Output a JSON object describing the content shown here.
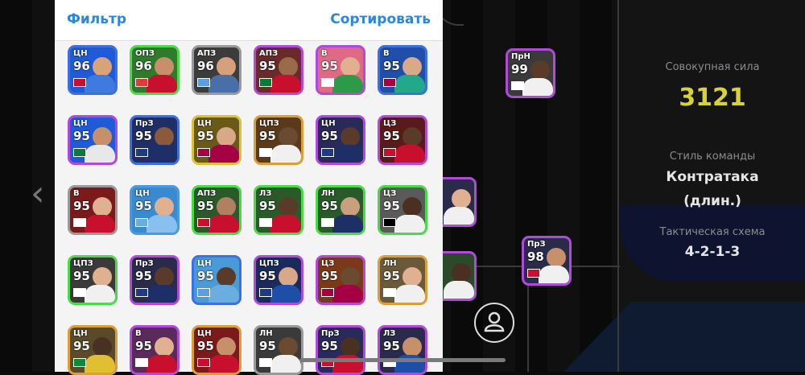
{
  "sidebar": {
    "filter_label": "Фильтр",
    "sort_label": "Сортировать"
  },
  "players": [
    {
      "position": "ЦН",
      "rating": "96",
      "border": "#3d6fe0",
      "bg": "#1f5bd8",
      "flag": "#c8102e",
      "head": "#d9a37a",
      "body": "#3e7be0"
    },
    {
      "position": "ОПЗ",
      "rating": "96",
      "border": "#4cd94a",
      "bg": "#2f7a2c",
      "flag": "#e03a3a",
      "head": "#c8906a",
      "body": "#c8102e"
    },
    {
      "position": "АПЗ",
      "rating": "96",
      "border": "#9a9a9a",
      "bg": "#3c3c3c",
      "flag": "#5aa0e0",
      "head": "#d6a07c",
      "body": "#4a6ea8"
    },
    {
      "position": "АПЗ",
      "rating": "95",
      "border": "#b04ad9",
      "bg": "#6b2a2a",
      "flag": "#0a7a3a",
      "head": "#9b6a4a",
      "body": "#c8102e"
    },
    {
      "position": "В",
      "rating": "95",
      "border": "#b04ad9",
      "bg": "#e06a86",
      "flag": "#ffffff",
      "head": "#e0b090",
      "body": "#2d9a4a"
    },
    {
      "position": "В",
      "rating": "95",
      "border": "#3d6fe0",
      "bg": "#1f4fa8",
      "flag": "#a50044",
      "head": "#d8aa8a",
      "body": "#22a88a"
    },
    {
      "position": "ЦН",
      "rating": "95",
      "border": "#b04ad9",
      "bg": "#1f5bd8",
      "flag": "#0a7a3a",
      "head": "#c8906a",
      "body": "#e8e8e8"
    },
    {
      "position": "ПрЗ",
      "rating": "95",
      "border": "#3d6fe0",
      "bg": "#1f2e66",
      "flag": "#1e3a8a",
      "head": "#8a5a3a",
      "body": "#1e2e66"
    },
    {
      "position": "ЦН",
      "rating": "95",
      "border": "#d9c23a",
      "bg": "#6a5a1a",
      "flag": "#a50044",
      "head": "#d8a888",
      "body": "#a50044"
    },
    {
      "position": "ЦПЗ",
      "rating": "95",
      "border": "#d9a03a",
      "bg": "#5a3a1a",
      "flag": "#ffffff",
      "head": "#6a4a30",
      "body": "#f0f0f0"
    },
    {
      "position": "ЦН",
      "rating": "95",
      "border": "#b04ad9",
      "bg": "#2a2a5a",
      "flag": "#1e3a8a",
      "head": "#5a3a28",
      "body": "#1e2e66"
    },
    {
      "position": "ЦЗ",
      "rating": "95",
      "border": "#b04ad9",
      "bg": "#5a1a1a",
      "flag": "#c8102e",
      "head": "#5a3a28",
      "body": "#c8102e"
    },
    {
      "position": "В",
      "rating": "95",
      "border": "#9a9a9a",
      "bg": "#7a1a1a",
      "flag": "#ffffff",
      "head": "#e0b090",
      "body": "#c8102e"
    },
    {
      "position": "ЦН",
      "rating": "95",
      "border": "#4a9ae0",
      "bg": "#3a8ad0",
      "flag": "#6aaee0",
      "head": "#e0b090",
      "body": "#8ac0f0"
    },
    {
      "position": "АПЗ",
      "rating": "95",
      "border": "#4cd94a",
      "bg": "#2a5a2a",
      "flag": "#c8102e",
      "head": "#b08060",
      "body": "#c8102e"
    },
    {
      "position": "ЛЗ",
      "rating": "95",
      "border": "#4cd94a",
      "bg": "#2a5a2a",
      "flag": "#ffffff",
      "head": "#5a3a28",
      "body": "#c8102e"
    },
    {
      "position": "ЛН",
      "rating": "95",
      "border": "#4cd94a",
      "bg": "#2a5a2a",
      "flag": "#ffffff",
      "head": "#c8a080",
      "body": "#1e2e66"
    },
    {
      "position": "ЦЗ",
      "rating": "95",
      "border": "#4cd94a",
      "bg": "#5a5a5a",
      "flag": "#000000",
      "head": "#4a3020",
      "body": "#f0f0f0"
    },
    {
      "position": "ЦПЗ",
      "rating": "95",
      "border": "#4cd94a",
      "bg": "#3a3a3a",
      "flag": "#ffffff",
      "head": "#e0b090",
      "body": "#f0f0f0"
    },
    {
      "position": "ПрЗ",
      "rating": "95",
      "border": "#b04ad9",
      "bg": "#2a2a4a",
      "flag": "#1e3a8a",
      "head": "#5a3a28",
      "body": "#1e2e66"
    },
    {
      "position": "ЦН",
      "rating": "95",
      "border": "#3d6fe0",
      "bg": "#4a9ad8",
      "flag": "#5aa0e0",
      "head": "#5a3a28",
      "body": "#6aaee0"
    },
    {
      "position": "ЦПЗ",
      "rating": "95",
      "border": "#b04ad9",
      "bg": "#1a2a5a",
      "flag": "#1e3a8a",
      "head": "#d8a888",
      "body": "#1e4fa8"
    },
    {
      "position": "ЦЗ",
      "rating": "95",
      "border": "#b04ad9",
      "bg": "#7a3a1a",
      "flag": "#a50044",
      "head": "#6a4a30",
      "body": "#a50044"
    },
    {
      "position": "ЛН",
      "rating": "95",
      "border": "#d9a03a",
      "bg": "#6a5a3a",
      "flag": "#ffffff",
      "head": "#e0b090",
      "body": "#f0f0f0"
    },
    {
      "position": "ЦН",
      "rating": "95",
      "border": "#d9a03a",
      "bg": "#5a4a2a",
      "flag": "#0a8a3a",
      "head": "#4a3020",
      "body": "#e0c030"
    },
    {
      "position": "В",
      "rating": "95",
      "border": "#b04ad9",
      "bg": "#5a2a5a",
      "flag": "#ffffff",
      "head": "#e0b090",
      "body": "#c8102e"
    },
    {
      "position": "ЦН",
      "rating": "95",
      "border": "#d9a03a",
      "bg": "#7a1a1a",
      "flag": "#c8102e",
      "head": "#c8906a",
      "body": "#c8102e"
    },
    {
      "position": "ЛН",
      "rating": "95",
      "border": "#9a9a9a",
      "bg": "#3a3a3a",
      "flag": "#ffffff",
      "head": "#6a4a30",
      "body": "#f0f0f0"
    },
    {
      "position": "ПрЗ",
      "rating": "95",
      "border": "#b04ad9",
      "bg": "#2a2a5a",
      "flag": "#c8102e",
      "head": "#4a3020",
      "body": "#c8102e"
    },
    {
      "position": "ЛЗ",
      "rating": "95",
      "border": "#b04ad9",
      "bg": "#2a2a4a",
      "flag": "#ffffff",
      "head": "#c8906a",
      "body": "#1e4fa8"
    }
  ],
  "pitch_players": [
    {
      "position": "ПрН",
      "rating": "99",
      "border": "#b04ad9",
      "bg": "#3a3a3a",
      "flag": "#ffffff",
      "head": "#5a3a28",
      "body": "#f0f0f0"
    },
    {
      "position": "",
      "rating": "",
      "border": "#b04ad9",
      "bg": "#2a2a4a",
      "flag": "",
      "head": "#e0b090",
      "body": "#f0f0f0"
    },
    {
      "position": "",
      "rating": "",
      "border": "#b04ad9",
      "bg": "#2a4a2a",
      "flag": "",
      "head": "#4a3020",
      "body": "#f0f0f0"
    },
    {
      "position": "ПрЗ",
      "rating": "98",
      "border": "#b04ad9",
      "bg": "#2a2a4a",
      "flag": "#c8102e",
      "head": "#c8906a",
      "body": "#f0f0f0"
    }
  ],
  "team_info": {
    "power_label": "Совокупная сила",
    "power_value": "3121",
    "style_label": "Стиль команды",
    "style_value_1": "Контратака",
    "style_value_2": "(длин.)",
    "formation_label": "Тактическая схема",
    "formation_value": "4-2-1-3"
  },
  "icons": {
    "back_chevron": "chevron-left-icon",
    "person": "person-icon"
  },
  "colors": {
    "accent_blue": "#2e86d6",
    "power_yellow": "#d8d234"
  }
}
